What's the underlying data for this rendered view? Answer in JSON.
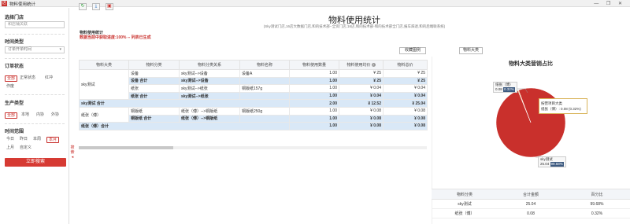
{
  "window": {
    "title": "物料使用统计",
    "logo_text": "店",
    "controls": "— ❐ ✕"
  },
  "toolbar": {
    "refresh_icon": "↻",
    "export_icon": "⤓",
    "print_icon": "▣"
  },
  "sidebar": {
    "store_label": "选择门店",
    "store_placeholder": "和店铺关联",
    "time_type_label": "时间类型",
    "time_type_value": "订单开单时间",
    "order_status_label": "订单状态",
    "order_status_options": [
      "全部",
      "正常状态",
      "红冲",
      "作废"
    ],
    "production_type_label": "生产类型",
    "production_type_options": [
      "全部",
      "本地",
      "内协",
      "外协"
    ],
    "time_range_label": "时间范围",
    "time_range_options": [
      "今日",
      "昨日",
      "本周",
      "本月",
      "上月",
      "自定义"
    ],
    "query_button": "立即搜索",
    "collapse_label": "搜索"
  },
  "report": {
    "title": "物料使用统计",
    "subtitle": "(Sky测试门店,16店大数据门店,和的技术部--全资门店,16店,和的技术部-和的技术部全门店,报车辞退,和的后端联系统)",
    "stat_name": "物料使用统计",
    "warn": "数据当前中获取进度:100% -- 列表已生成",
    "collect_button": "收藏图例",
    "chart_tab": "物料大类",
    "help_icon": "?",
    "columns": [
      "物料大类",
      "物料分类",
      "物料分类关系",
      "物料名称",
      "物料使用数量",
      "物料使用均价",
      "物料总价"
    ],
    "rows": [
      {
        "type": "item",
        "cat": "sky测试",
        "c2": "设备",
        "c3": "sky测试-->设备",
        "c4": "设备A",
        "c5": "1.00",
        "c6": "¥ 25",
        "c7": "¥ 25"
      },
      {
        "type": "sub",
        "c2": "设备 合计",
        "c3": "sky测试-->设备",
        "c4": "",
        "c5": "1.00",
        "c6": "¥ 25",
        "c7": "¥ 25"
      },
      {
        "type": "item",
        "c2": "纸张",
        "c3": "sky测试-->纸张",
        "c4": "铜版纸157g",
        "c5": "1.00",
        "c6": "¥ 0.04",
        "c7": "¥ 0.04"
      },
      {
        "type": "sub",
        "c2": "纸张 合计",
        "c3": "sky测试-->纸张",
        "c4": "",
        "c5": "1.00",
        "c6": "¥ 0.04",
        "c7": "¥ 0.04"
      },
      {
        "type": "total",
        "c1": "sky测试 合计",
        "c5": "2.00",
        "c6": "¥ 12.52",
        "c7": "¥ 25.04"
      },
      {
        "type": "item",
        "cat": "纸张（傅）",
        "c2": "铜版纸",
        "c3": "纸张（傅）-->铜版纸",
        "c4": "铜版纸250g",
        "c5": "1.00",
        "c6": "¥ 0.08",
        "c7": "¥ 0.08"
      },
      {
        "type": "sub",
        "c2": "铜版纸 合计",
        "c3": "纸张（傅）-->铜版纸",
        "c4": "",
        "c5": "1.00",
        "c6": "¥ 0.08",
        "c7": "¥ 0.08"
      },
      {
        "type": "total",
        "c1": "纸张（傅）合计",
        "c5": "1.00",
        "c6": "¥ 0.08",
        "c7": "¥ 0.08"
      }
    ]
  },
  "chart_data": {
    "type": "pie",
    "title": "物料大类营销占比",
    "slices": [
      {
        "name": "sky测试",
        "value": 25.04,
        "percent": "99.68%",
        "color": "#c9302c"
      },
      {
        "name": "纸张（傅）",
        "value": 0.08,
        "percent": "0.32%",
        "color": "#f0a33a"
      }
    ],
    "labels": {
      "sky_name": "sky测试",
      "sky_value": "25.04",
      "sky_pct": "99.68%",
      "paper_name": "纸张（傅）",
      "paper_value": "0.08",
      "paper_pct": "0.32%"
    },
    "tooltip": {
      "title": "按营项目大类",
      "body": "纸张（傅）: 0.08 (0.32%)"
    }
  },
  "legend_table": {
    "columns": [
      "物料分类",
      "合计金额",
      "百分比"
    ],
    "rows": [
      {
        "name": "sky测试",
        "amount": "25.04",
        "pct": "99.68%"
      },
      {
        "name": "纸张（傅）",
        "amount": "0.08",
        "pct": "0.32%"
      }
    ]
  }
}
